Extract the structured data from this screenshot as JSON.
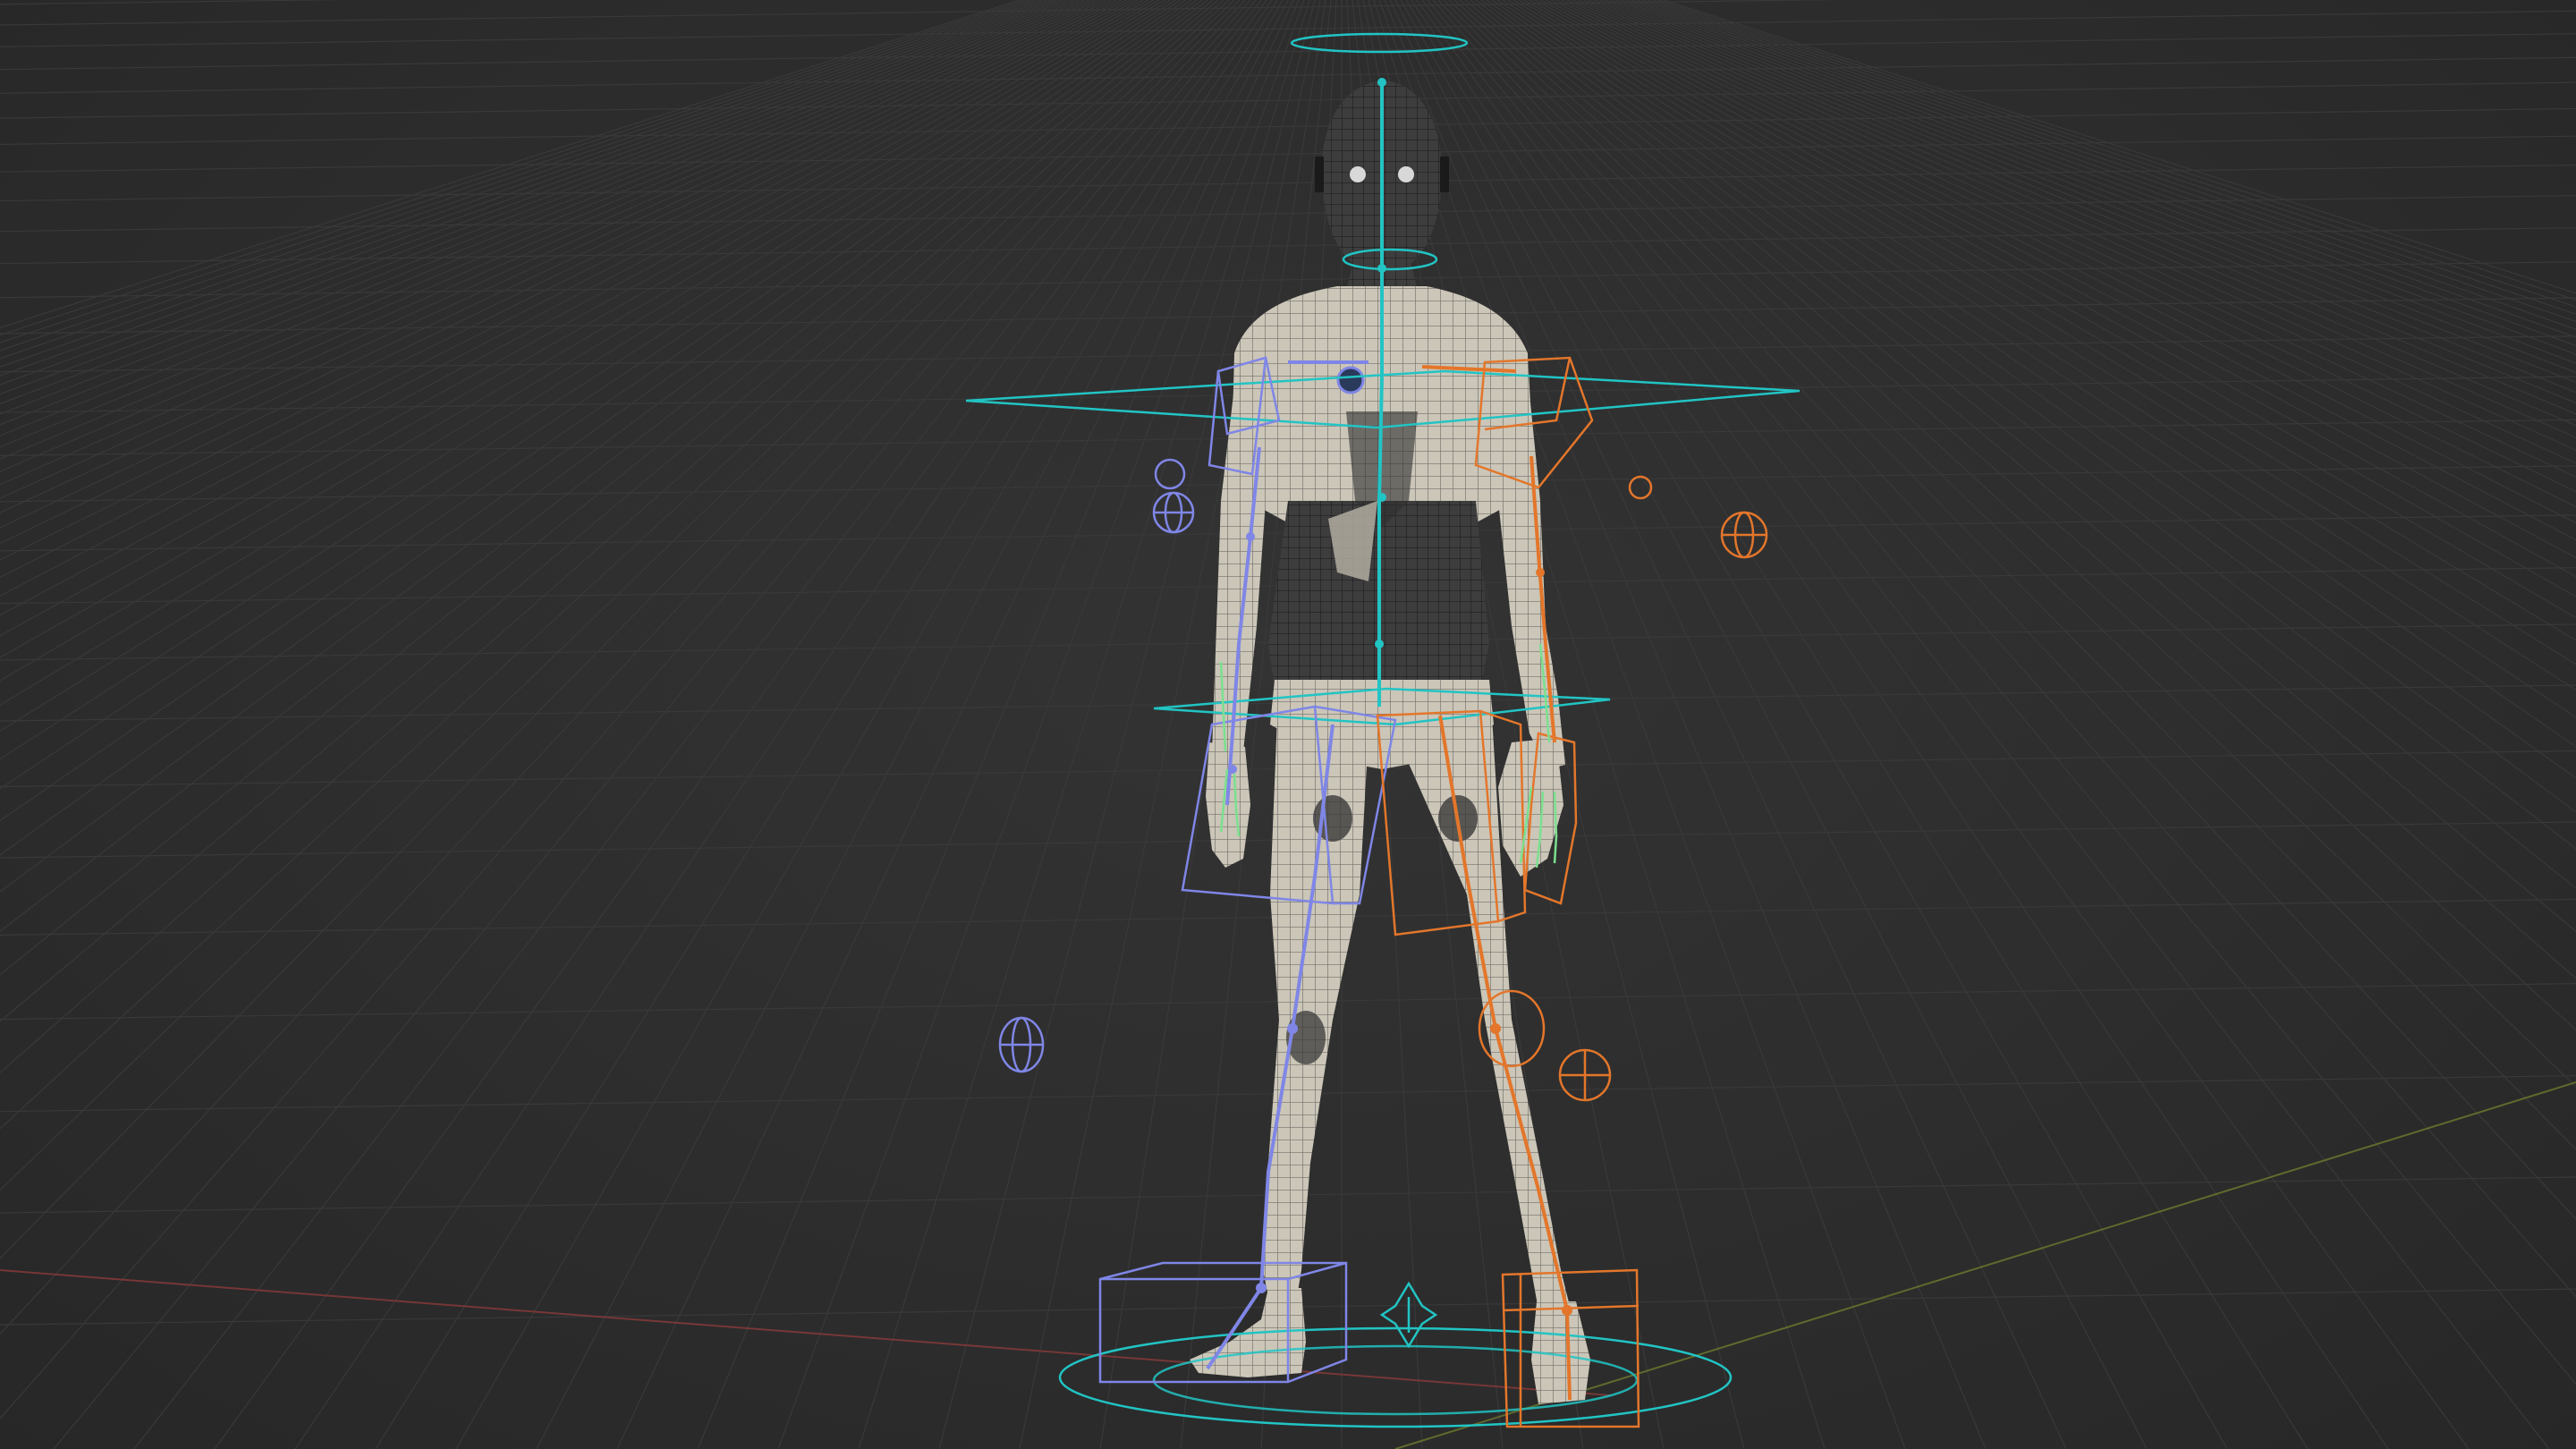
{
  "viewport": {
    "type": "3d-viewport",
    "background": "#2b2b2b",
    "grid_color": "#393939",
    "x_axis_color": "#8a3a3a",
    "y_axis_color": "#6d7a2e"
  },
  "rig": {
    "spine_color": "#22c4c4",
    "left_side_color": "#7f86e6",
    "right_side_color": "#e3762b",
    "finger_color": "#7be08f",
    "mesh_color": "#c9c4b6"
  }
}
